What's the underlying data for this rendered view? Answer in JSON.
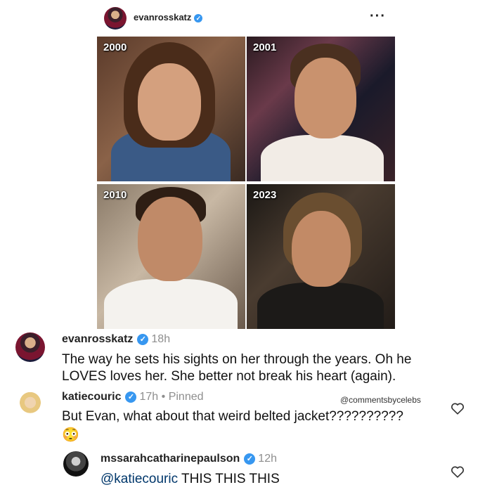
{
  "post": {
    "username": "evanrosskatz",
    "verified_mark": "✓",
    "more_label": "···",
    "grid": [
      {
        "year": "2000"
      },
      {
        "year": "2001"
      },
      {
        "year": "2010"
      },
      {
        "year": "2023"
      }
    ]
  },
  "comments": [
    {
      "username": "evanrosskatz",
      "time": "18h",
      "text": "The way he sets his sights on her through the years. Oh he LOVES loves her. She better not break his heart (again)."
    },
    {
      "username": "katiecouric",
      "time": "17h",
      "separator": "•",
      "pinned": "Pinned",
      "text": "But Evan, what about that weird belted jacket??????????",
      "emoji": "😳",
      "watermark": "@commentsbycelebs"
    },
    {
      "username": "mssarahcatharinepaulson",
      "time": "12h",
      "mention": "@katiecouric",
      "text": " THIS THIS THIS"
    }
  ],
  "icons": {
    "verified": "verified-badge-icon",
    "heart": "heart-icon",
    "more": "more-options-icon"
  },
  "colors": {
    "verified": "#3797f0",
    "meta_gray": "#8e8e8e",
    "mention": "#00376b"
  }
}
